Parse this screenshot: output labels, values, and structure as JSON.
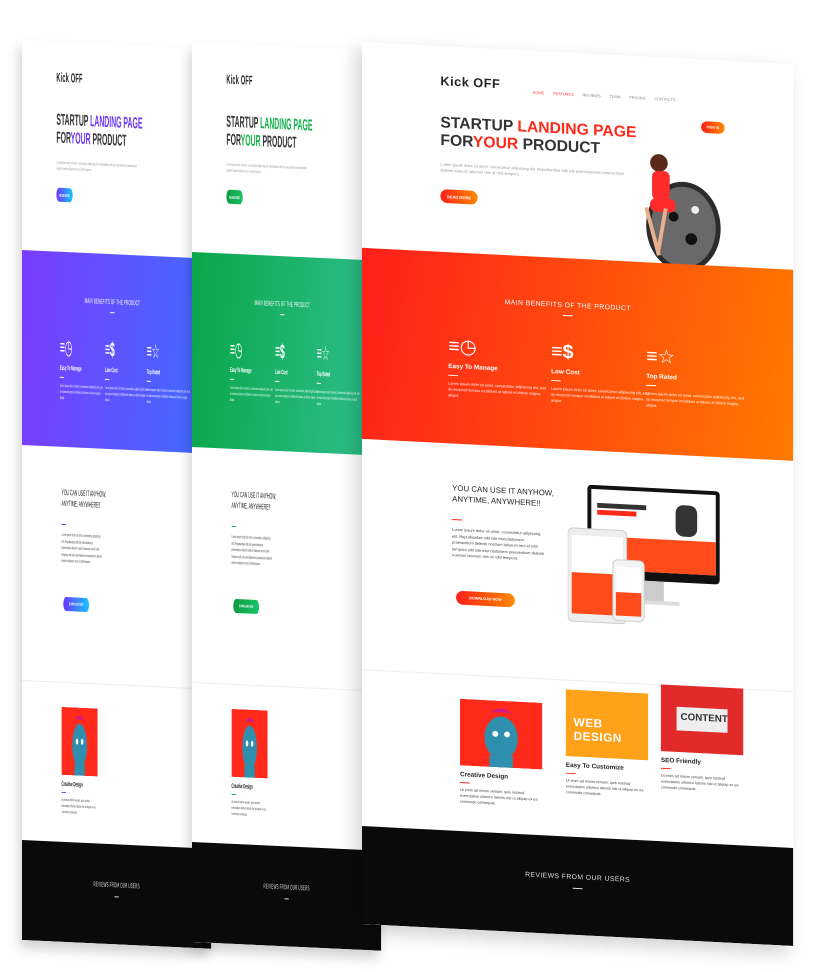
{
  "logo": "Kick OFF",
  "nav": [
    "HOME",
    "FEATURES",
    "REVIEWS",
    "TEAM",
    "PRICING",
    "CONTACTS"
  ],
  "nav_cta": "SIGN IN",
  "hero": {
    "line1_a": "STARTUP ",
    "line1_b": "LANDING PAGE",
    "line2_a": "FOR",
    "line2_b": "YOUR",
    "line2_c": " PRODUCT",
    "subtitle": "Lorem ipsum dolor sit amet, consectetur adipiscing elit. Repudiandae odit iste exercitationem praesentium deleniti nostrum laborum rem id nihil tempora.",
    "button": "READ MORE"
  },
  "benefits": {
    "title": "MAIN BENEFITS OF THE PRODUCT",
    "items": [
      {
        "icon": "clock-icon",
        "title": "Easy To Manage",
        "text": "Lorem ipsum dolor sit amet, consectetur adipiscing elit, sed do eiusmod tempor incididunt ut labore et dolore magna aliqua."
      },
      {
        "icon": "dollar-icon",
        "title": "Low Cost",
        "text": "Lorem ipsum dolor sit amet, consectetur adipiscing elit, sed do eiusmod tempor incididunt ut labore et dolore magna aliqua."
      },
      {
        "icon": "star-icon",
        "title": "Top Rated",
        "text": "Lorem ipsum dolor sit amet, consectetur adipiscing elit, sed do eiusmod tempor incididunt ut labore et dolore magna aliqua."
      }
    ]
  },
  "use": {
    "title": "YOU CAN USE IT ANYHOW, ANYTIME, ANYWHERE!!",
    "text": "Lorem ipsum dolor sit amet, consectetur adipiscing elit. Repudiandae odit iste exercitationem praesentium deleniti nostrum laborum rem id nihil tempora odit iste exercitationem praesentium deleniti nostrum laborum rem id nihil tempora.",
    "button": "DOWNLOAD NOW"
  },
  "cards": [
    {
      "title": "Creative Design",
      "text": "Ut enim ad minim veniam, quis nostrud exercitation ullamco laboris nisi ut aliquip ex ea commodo consequat."
    },
    {
      "title": "Easy To Customize",
      "text": "Ut enim ad minim veniam, quis nostrud exercitation ullamco laboris nisi ut aliquip ex ea commodo consequat.",
      "image_text": "WEB DESIGN"
    },
    {
      "title": "SEO Friendly",
      "text": "Ut enim ad minim veniam, quis nostrud exercitation ullamco laboris nisi ut aliquip ex ea commodo consequat.",
      "image_text": "CONTENT"
    }
  ],
  "reviews_title": "REVIEWS FROM OUR USERS",
  "themes": [
    {
      "name": "purple",
      "accent": "#6a35ff",
      "band_from": "#7b3cff",
      "band_to": "#3f6dff",
      "btn_from": "#6a35ff",
      "btn_to": "#16c8ff"
    },
    {
      "name": "green",
      "accent": "#12b04a",
      "band_from": "#0aa64a",
      "band_to": "#2fc08e",
      "btn_from": "#0e9a3e",
      "btn_to": "#19c46a"
    },
    {
      "name": "orange",
      "accent": "#ff2a1a",
      "band_from": "#ff1f1a",
      "band_to": "#ff7a00",
      "btn_from": "#ff1f1a",
      "btn_to": "#ff8a00"
    }
  ]
}
